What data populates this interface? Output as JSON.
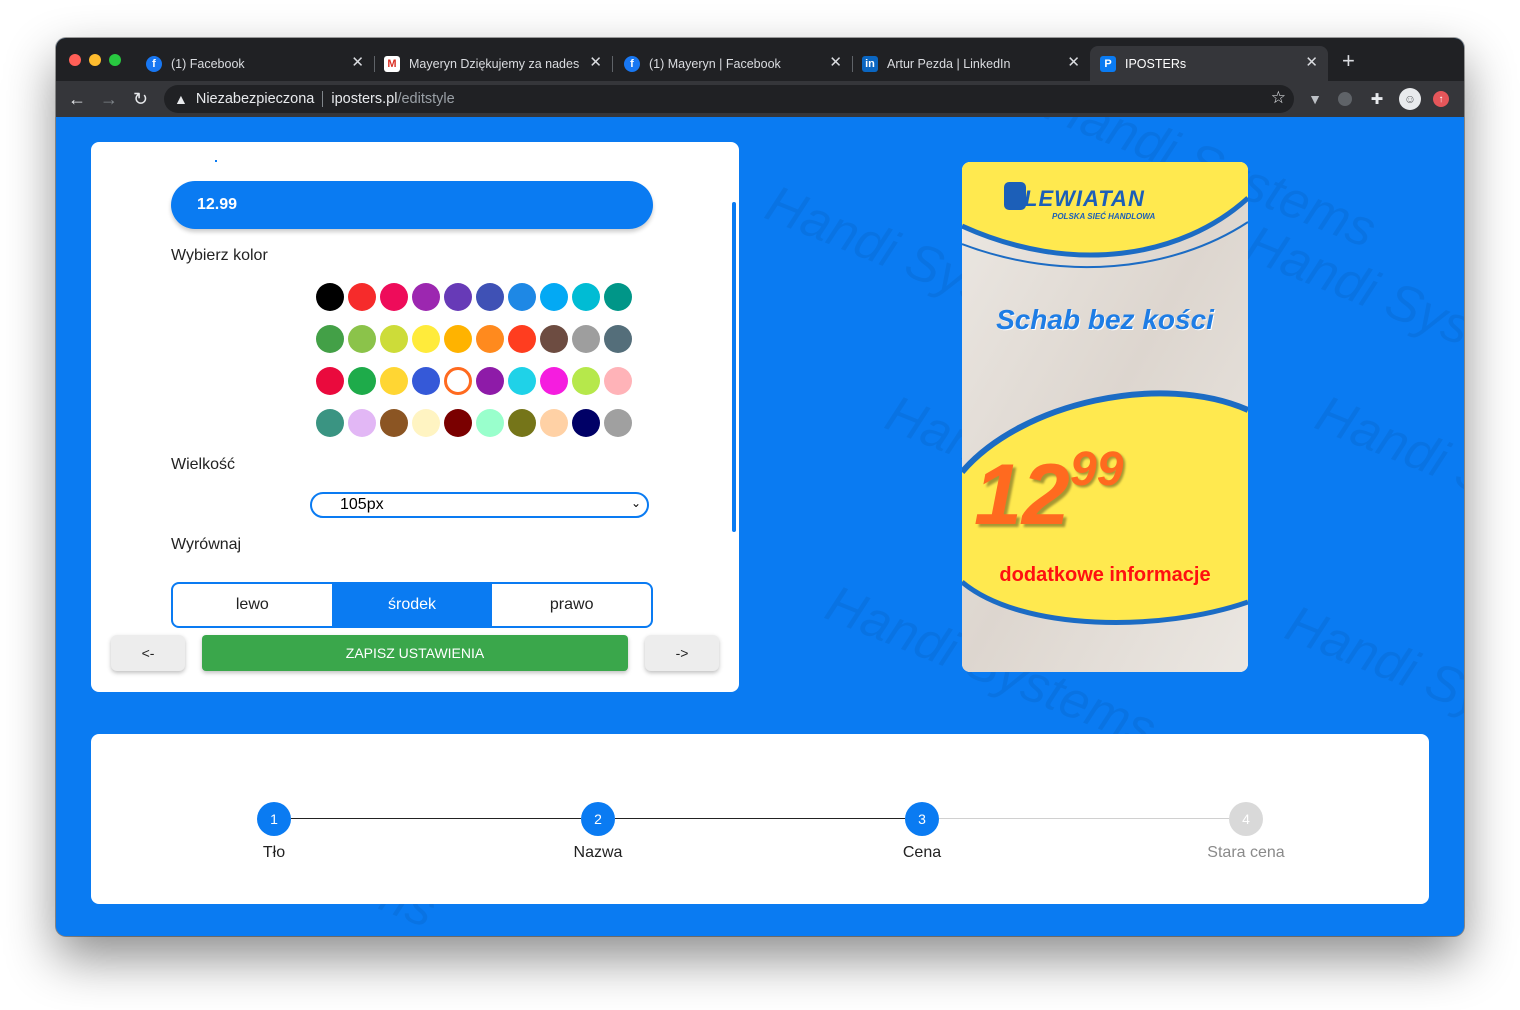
{
  "browser": {
    "tabs": [
      {
        "title": "(1) Facebook",
        "icon": "facebook-icon"
      },
      {
        "title": "Mayeryn Dziękujemy za nadesła",
        "icon": "gmail-icon"
      },
      {
        "title": "(1) Mayeryn | Facebook",
        "icon": "facebook-icon"
      },
      {
        "title": "Artur Pezda | LinkedIn",
        "icon": "linkedin-icon"
      },
      {
        "title": "IPOSTERs",
        "icon": "iposters-icon",
        "active": true
      }
    ],
    "address": {
      "security": "Niezabezpieczona",
      "host": "iposters.pl",
      "path": "/editstyle"
    }
  },
  "editor": {
    "price_value": "12.99",
    "color_label": "Wybierz kolor",
    "colors": [
      [
        "#000000",
        "#f62b2b",
        "#ee0c5a",
        "#9c27b0",
        "#673ab7",
        "#3f51b5",
        "#1e88e5",
        "#03a9f4",
        "#00bcd4",
        "#009688"
      ],
      [
        "#43a047",
        "#8bc34a",
        "#cddc39",
        "#ffeb3b",
        "#ffb300",
        "#ff8a1e",
        "#ff3d1f",
        "#6d4c41",
        "#9e9e9e",
        "#546e7a"
      ],
      [
        "#ea0a3d",
        "#1eab4a",
        "#ffd633",
        "#3559d8",
        "#ffffff",
        "#8e1ba8",
        "#1fd2e8",
        "#f51ddf",
        "#b6e84b",
        "#ffb3b8"
      ],
      [
        "#3a9482",
        "#e2b7f5",
        "#8b5523",
        "#fff4c2",
        "#7a0000",
        "#99ffcc",
        "#757519",
        "#ffd1a5",
        "#000066",
        "#a0a0a0"
      ]
    ],
    "selected_color": "#ffffff",
    "size_label": "Wielkość",
    "size_value": "105px",
    "align_label": "Wyrównaj",
    "align_options": [
      "lewo",
      "środek",
      "prawo"
    ],
    "align_selected": "środek",
    "prev_label": "<-",
    "save_label": "ZAPISZ USTAWIENIA",
    "next_label": "->"
  },
  "poster": {
    "logo_text": "LEWIATAN",
    "logo_sub": "POLSKA SIEĆ HANDLOWA",
    "product": "Schab bez kości",
    "price_main": "12",
    "price_cents": "99",
    "info": "dodatkowe informacje"
  },
  "watermark": "Handi Systems",
  "steps": [
    {
      "num": "1",
      "label": "Tło",
      "state": "done"
    },
    {
      "num": "2",
      "label": "Nazwa",
      "state": "done"
    },
    {
      "num": "3",
      "label": "Cena",
      "state": "active"
    },
    {
      "num": "4",
      "label": "Stara cena",
      "state": "todo"
    }
  ]
}
